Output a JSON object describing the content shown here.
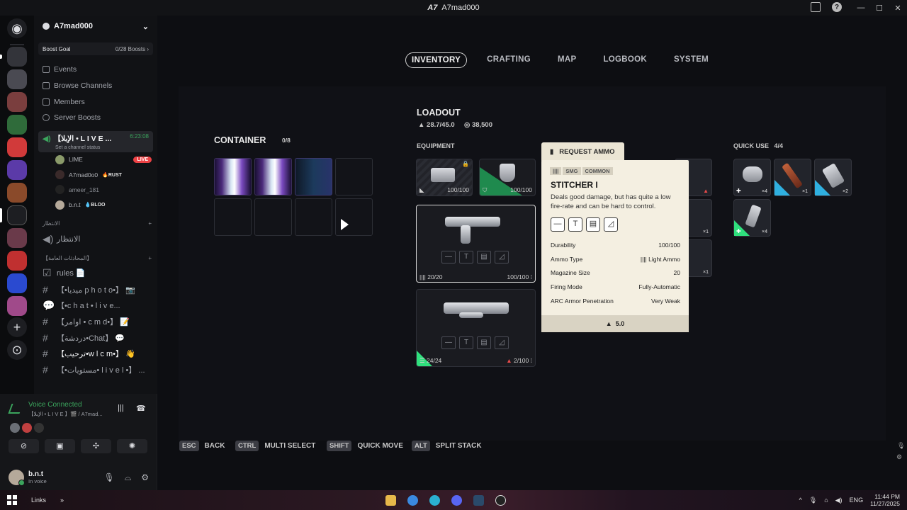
{
  "window": {
    "title": "A7mad000",
    "logo": "A7"
  },
  "server": {
    "name": "A7mad000",
    "boost_goal": "Boost Goal",
    "boost_count": "0/28 Boosts",
    "nav": [
      "Events",
      "Browse Channels",
      "Members",
      "Server Boosts"
    ],
    "voice_channel": {
      "name": "【الإبلا • L I V E ...",
      "time": "6:23:08",
      "status": "Set a channel status"
    },
    "voice_users": [
      {
        "name": "LIME",
        "badge": "LIVE"
      },
      {
        "name": "A7mad0o0",
        "badge": "RUST"
      },
      {
        "name": "ameer_181",
        "badge": ""
      },
      {
        "name": "b.n.t",
        "badge": "BLOO"
      }
    ],
    "category1": "الانتظار",
    "waiting_channel": "الانتظار",
    "category2": "【المحادثات العامة】",
    "channels": [
      {
        "name": "rules 📄",
        "bright": false
      },
      {
        "name": "【•ميديا p h o t o•】 📷",
        "bright": false
      },
      {
        "name": "【•c h a t • l i v e...",
        "bright": false
      },
      {
        "name": "【اوامر • c m d•】 📝",
        "bright": false
      },
      {
        "name": "【دردشة•Chat】 💬",
        "bright": false
      },
      {
        "name": "【ترحيب•w l c m•】 👋",
        "bright": true
      },
      {
        "name": "【•مستويات• l i v e l •】 ...",
        "bright": false
      }
    ]
  },
  "voice_panel": {
    "status": "Voice Connected",
    "channel": "【الإبلا • L I V E 】🎬 / A7mad...",
    "user_name": "b.n.t",
    "user_status": "In voice"
  },
  "game": {
    "tabs": [
      "INVENTORY",
      "CRAFTING",
      "MAP",
      "LOGBOOK",
      "SYSTEM"
    ],
    "active_tab": "INVENTORY",
    "container": {
      "title": "CONTAINER",
      "count": "0/8"
    },
    "loadout": {
      "title": "LOADOUT",
      "weight": "28.7/45.0",
      "coins": "38,500"
    },
    "equipment_label": "EQUIPMENT",
    "equipment": [
      {
        "durability": "100/100"
      },
      {
        "durability": "100/100"
      }
    ],
    "weapon1": {
      "ammo": "20/20",
      "durability": "100/100"
    },
    "weapon2": {
      "ammo": "24/24",
      "durability": "2/100"
    },
    "quick_use": {
      "title": "QUICK USE",
      "count": "4/4",
      "items": [
        "×4",
        "×1",
        "×2",
        "×4"
      ]
    },
    "side_qty": [
      "×1",
      "×1"
    ],
    "tooltip": {
      "tab": "REQUEST AMMO",
      "badges": [
        "SMG",
        "COMMON"
      ],
      "name": "STITCHER I",
      "description": "Deals good damage, but has quite a low fire-rate and can be hard to control.",
      "stats": [
        {
          "label": "Durability",
          "value": "100/100"
        },
        {
          "label": "Ammo Type",
          "value": "Light Ammo"
        },
        {
          "label": "Magazine Size",
          "value": "20"
        },
        {
          "label": "Firing Mode",
          "value": "Fully-Automatic"
        },
        {
          "label": "ARC Armor Penetration",
          "value": "Very Weak"
        }
      ],
      "weight": "5.0"
    },
    "hints": [
      {
        "key": "ESC",
        "label": "BACK"
      },
      {
        "key": "CTRL",
        "label": "MULTI SELECT"
      },
      {
        "key": "SHIFT",
        "label": "QUICK MOVE"
      },
      {
        "key": "ALT",
        "label": "SPLIT STACK"
      }
    ]
  },
  "taskbar": {
    "links": "Links",
    "lang": "ENG",
    "time": "11:44 PM",
    "date": "11/27/2025"
  },
  "colors": {
    "accent_green": "#3ba55d",
    "live_red": "#ed4245",
    "tooltip_bg": "#f4efe1",
    "rarity_green": "#2fe07d"
  }
}
